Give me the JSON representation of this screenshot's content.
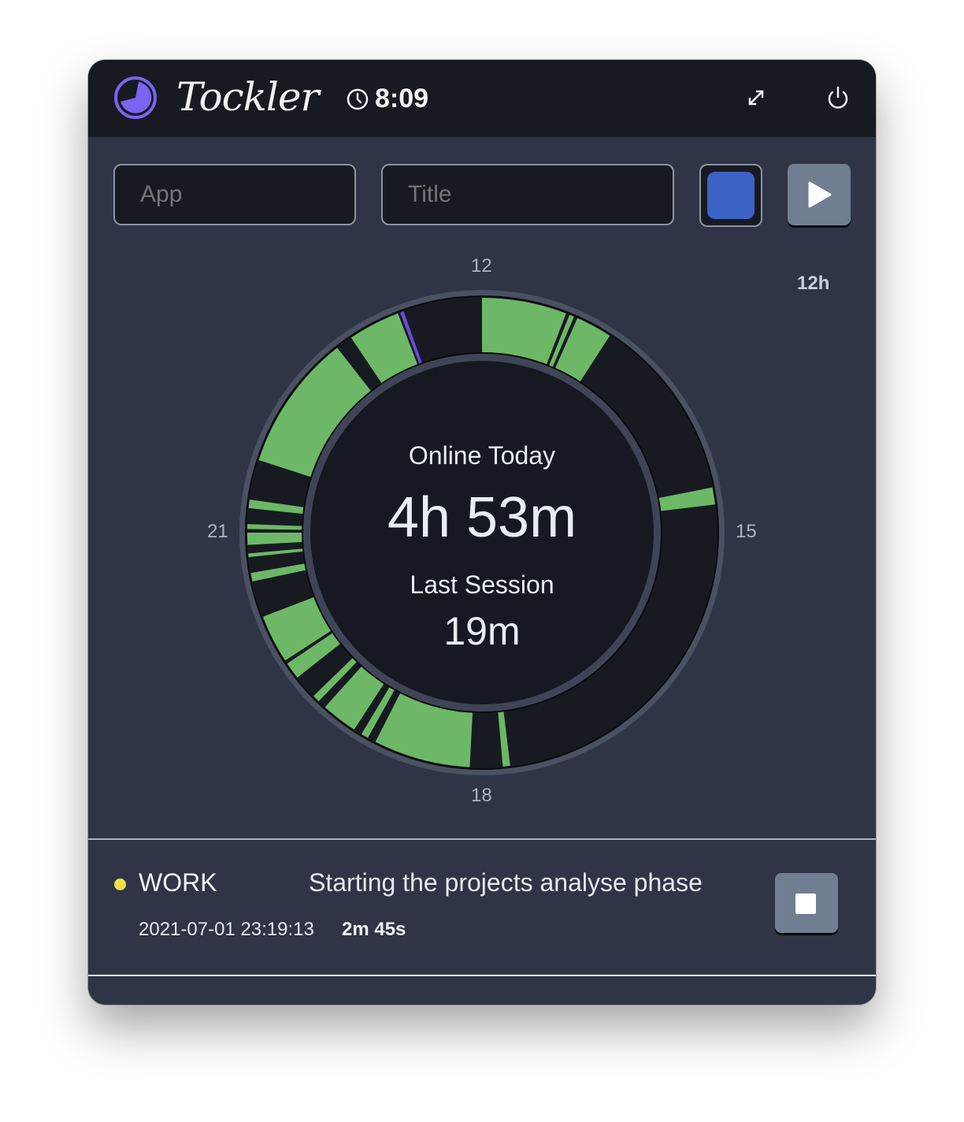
{
  "header": {
    "app_name": "Tockler",
    "clock_time": "8:09",
    "icons": [
      "tockler-logo-icon",
      "clock-icon",
      "expand-icon",
      "power-icon"
    ]
  },
  "controls": {
    "app_placeholder": "App",
    "title_placeholder": "Title",
    "selected_color": "#3d62c6",
    "play_icon": "play-icon"
  },
  "dial": {
    "zoom_label": "12h",
    "hour_labels": {
      "top": "12",
      "right": "15",
      "bottom": "18",
      "left": "21"
    },
    "online_today_label": "Online Today",
    "online_today_value": "4h 53m",
    "last_session_label": "Last Session",
    "last_session_value": "19m"
  },
  "chart_data": {
    "type": "radial-timeline",
    "range_hours": [
      12,
      24
    ],
    "colors": {
      "online": "#6db866",
      "task": "#6a4bd6",
      "track": "#181a22"
    },
    "segments": [
      {
        "start": 12.0,
        "end": 12.7,
        "kind": "online"
      },
      {
        "start": 12.73,
        "end": 12.77,
        "kind": "online"
      },
      {
        "start": 12.8,
        "end": 13.1,
        "kind": "online"
      },
      {
        "start": 14.63,
        "end": 14.77,
        "kind": "online"
      },
      {
        "start": 17.77,
        "end": 17.83,
        "kind": "online"
      },
      {
        "start": 18.1,
        "end": 18.9,
        "kind": "online"
      },
      {
        "start": 18.97,
        "end": 19.03,
        "kind": "online"
      },
      {
        "start": 19.1,
        "end": 19.4,
        "kind": "online"
      },
      {
        "start": 19.47,
        "end": 19.53,
        "kind": "online"
      },
      {
        "start": 19.73,
        "end": 19.87,
        "kind": "online"
      },
      {
        "start": 19.9,
        "end": 20.3,
        "kind": "online"
      },
      {
        "start": 20.6,
        "end": 20.67,
        "kind": "online"
      },
      {
        "start": 20.8,
        "end": 20.83,
        "kind": "online"
      },
      {
        "start": 20.9,
        "end": 21.0,
        "kind": "online"
      },
      {
        "start": 21.03,
        "end": 21.07,
        "kind": "online"
      },
      {
        "start": 21.2,
        "end": 21.27,
        "kind": "online"
      },
      {
        "start": 21.6,
        "end": 22.73,
        "kind": "online"
      },
      {
        "start": 22.87,
        "end": 23.3,
        "kind": "online"
      },
      {
        "start": 23.32,
        "end": 23.35,
        "kind": "task"
      }
    ]
  },
  "current_task": {
    "status_color": "#f2e04a",
    "app": "WORK",
    "title": "Starting the projects analyse phase",
    "started_at": "2021-07-01 23:19:13",
    "duration": "2m 45s",
    "stop_icon": "stop-icon"
  }
}
